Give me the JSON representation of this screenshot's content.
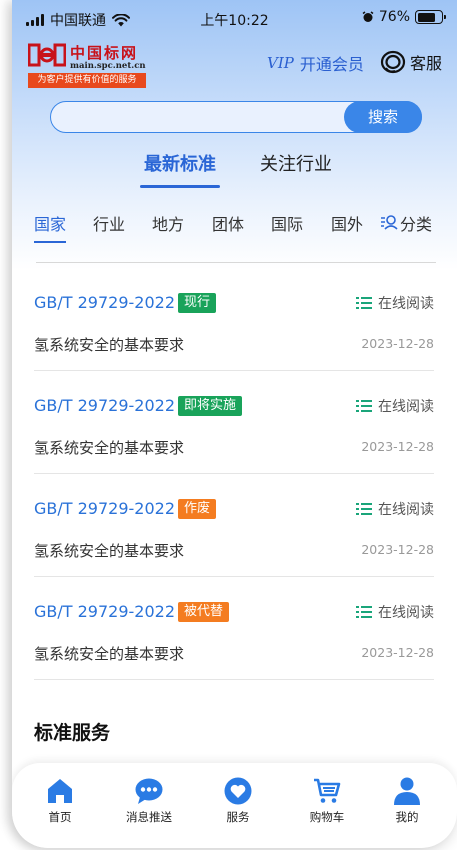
{
  "status_bar": {
    "carrier": "中国联通",
    "time": "上午10:22",
    "battery": "76%",
    "battery_level": 0.76
  },
  "header": {
    "logo_name": "中国标网",
    "logo_url": "main.spc.net.cn",
    "logo_slogan": "为客户提供有价值的服务",
    "vip_tag": "VIP",
    "vip_label": "开通会员",
    "service_label": "客服"
  },
  "search": {
    "placeholder": "",
    "value": "",
    "button_label": "搜索"
  },
  "top_tabs": [
    {
      "label": "最新标准",
      "active": true
    },
    {
      "label": "关注行业",
      "active": false
    }
  ],
  "category_tabs": [
    "国家",
    "行业",
    "地方",
    "团体",
    "国际",
    "国外"
  ],
  "category_filter_label": "分类",
  "standards": [
    {
      "code": "GB/T 29729-2022",
      "status": "现行",
      "status_color": "#19a35a",
      "read_label": "在线阅读",
      "title": "氢系统安全的基本要求",
      "date": "2023-12-28"
    },
    {
      "code": "GB/T 29729-2022",
      "status": "即将实施",
      "status_color": "#19a35a",
      "read_label": "在线阅读",
      "title": "氢系统安全的基本要求",
      "date": "2023-12-28"
    },
    {
      "code": "GB/T 29729-2022",
      "status": "作废",
      "status_color": "#f47c20",
      "read_label": "在线阅读",
      "title": "氢系统安全的基本要求",
      "date": "2023-12-28"
    },
    {
      "code": "GB/T 29729-2022",
      "status": "被代替",
      "status_color": "#f47c20",
      "read_label": "在线阅读",
      "title": "氢系统安全的基本要求",
      "date": "2023-12-28"
    }
  ],
  "section_title": "标准服务",
  "bottom_nav": [
    {
      "label": "首页",
      "icon": "home-icon"
    },
    {
      "label": "消息推送",
      "icon": "message-icon"
    },
    {
      "label": "服务",
      "icon": "heart-icon"
    },
    {
      "label": "购物车",
      "icon": "cart-icon"
    },
    {
      "label": "我的",
      "icon": "user-icon"
    }
  ],
  "colors": {
    "accent": "#2a66d6",
    "search_button": "#3a86e8",
    "logo_red": "#c8121a",
    "nav_icon": "#2a7be4"
  }
}
